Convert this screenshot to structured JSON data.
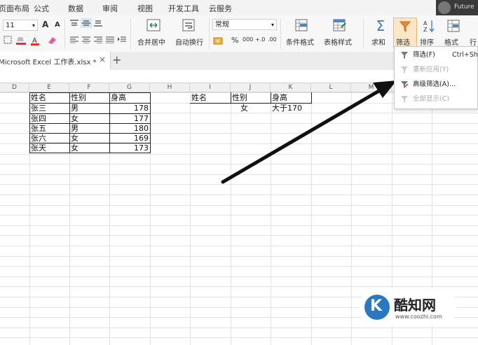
{
  "menu": {
    "items": [
      "页面布局",
      "公式",
      "数据",
      "审阅",
      "视图",
      "开发工具",
      "云服务"
    ],
    "profile_text": "Future"
  },
  "ribbon": {
    "font_size": "11",
    "font_grow": "A",
    "font_shrink": "A",
    "merge_center": "合并居中",
    "wrap_text": "自动换行",
    "number_format": "常规",
    "percent": "%",
    "thousands": "000",
    "dec_inc": "+.0",
    "dec_dec": ".00",
    "cond_format": "条件格式",
    "table_style": "表格样式",
    "sum": "求和",
    "filter": "筛选",
    "sort": "排序",
    "format": "格式",
    "row_col": "行"
  },
  "tabbar": {
    "doc_name": "Microsoft Excel 工作表.xlsx *",
    "close": "×",
    "add": "+"
  },
  "columns": [
    "D",
    "E",
    "F",
    "G",
    "H",
    "I",
    "J",
    "K",
    "L",
    "M"
  ],
  "left_table": {
    "headers": [
      "姓名",
      "性别",
      "身高"
    ],
    "rows": [
      [
        "张三",
        "男",
        "178"
      ],
      [
        "张四",
        "女",
        "177"
      ],
      [
        "张五",
        "男",
        "180"
      ],
      [
        "张六",
        "女",
        "169"
      ],
      [
        "张天",
        "女",
        "173"
      ]
    ]
  },
  "criteria_table": {
    "headers": [
      "姓名",
      "性别",
      "身高"
    ],
    "row": [
      "",
      "女",
      "大于170"
    ]
  },
  "filter_menu": {
    "items": [
      {
        "label": "筛选(F)",
        "shortcut": "Ctrl+Shi",
        "enabled": true
      },
      {
        "label": "重新应用(Y)",
        "shortcut": "",
        "enabled": false
      },
      {
        "label": "高级筛选(A)...",
        "shortcut": "",
        "enabled": true
      },
      {
        "label": "全部显示(C)",
        "shortcut": "",
        "enabled": false
      }
    ]
  },
  "watermark": {
    "brand": "酷知网",
    "url": "www.coozhi.com"
  },
  "colors": {
    "accent_green": "#1e7c45",
    "filter_orange": "#f08a24",
    "sum_blue": "#3a78c9"
  }
}
